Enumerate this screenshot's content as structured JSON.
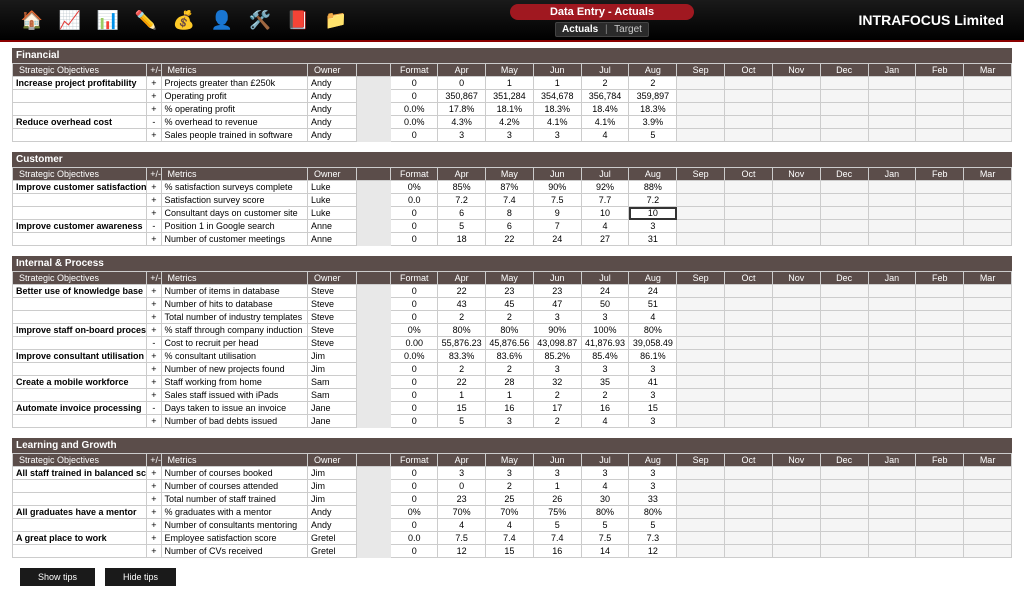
{
  "header": {
    "title": "Data Entry - Actuals",
    "tabs": {
      "actuals": "Actuals",
      "target": "Target"
    },
    "company": "INTRAFOCUS Limited",
    "icons": [
      "home-icon",
      "chart-icon",
      "bar-chart-icon",
      "pencil-icon",
      "coins-icon",
      "person-icon",
      "tools-icon",
      "book-icon",
      "folder-icon"
    ]
  },
  "months": [
    "Apr",
    "May",
    "Jun",
    "Jul",
    "Aug",
    "Sep",
    "Oct",
    "Nov",
    "Dec",
    "Jan",
    "Feb",
    "Mar"
  ],
  "column_headers": {
    "objectives": "Strategic Objectives",
    "pm": "+/-",
    "metrics": "Metrics",
    "owner": "Owner",
    "format": "Format"
  },
  "sections": [
    {
      "title": "Financial",
      "rows": [
        {
          "obj": "Increase project profitability",
          "pm": "+",
          "metric": "Projects greater than £250k",
          "owner": "Andy",
          "fmt": "0",
          "vals": [
            "0",
            "1",
            "1",
            "2",
            "2",
            "",
            "",
            "",
            "",
            "",
            "",
            ""
          ]
        },
        {
          "obj": "",
          "pm": "+",
          "metric": "Operating profit",
          "owner": "Andy",
          "fmt": "0",
          "vals": [
            "350,867",
            "351,284",
            "354,678",
            "356,784",
            "359,897",
            "",
            "",
            "",
            "",
            "",
            "",
            ""
          ]
        },
        {
          "obj": "",
          "pm": "+",
          "metric": "% operating profit",
          "owner": "Andy",
          "fmt": "0.0%",
          "vals": [
            "17.8%",
            "18.1%",
            "18.3%",
            "18.4%",
            "18.3%",
            "",
            "",
            "",
            "",
            "",
            "",
            ""
          ]
        },
        {
          "obj": "Reduce overhead cost",
          "pm": "-",
          "metric": "% overhead to revenue",
          "owner": "Andy",
          "fmt": "0.0%",
          "vals": [
            "4.3%",
            "4.2%",
            "4.1%",
            "4.1%",
            "3.9%",
            "",
            "",
            "",
            "",
            "",
            "",
            ""
          ]
        },
        {
          "obj": "",
          "pm": "+",
          "metric": "Sales people trained in software",
          "owner": "Andy",
          "fmt": "0",
          "vals": [
            "3",
            "3",
            "3",
            "4",
            "5",
            "",
            "",
            "",
            "",
            "",
            "",
            ""
          ]
        }
      ]
    },
    {
      "title": "Customer",
      "rows": [
        {
          "obj": "Improve customer satisfaction",
          "pm": "+",
          "metric": "% satisfaction surveys complete",
          "owner": "Luke",
          "fmt": "0%",
          "vals": [
            "85%",
            "87%",
            "90%",
            "92%",
            "88%",
            "",
            "",
            "",
            "",
            "",
            "",
            ""
          ]
        },
        {
          "obj": "",
          "pm": "+",
          "metric": "Satisfaction survey score",
          "owner": "Luke",
          "fmt": "0.0",
          "vals": [
            "7.2",
            "7.4",
            "7.5",
            "7.7",
            "7.2",
            "",
            "",
            "",
            "",
            "",
            "",
            ""
          ]
        },
        {
          "obj": "",
          "pm": "+",
          "metric": "Consultant days on customer site",
          "owner": "Luke",
          "fmt": "0",
          "vals": [
            "6",
            "8",
            "9",
            "10",
            "10",
            "",
            "",
            "",
            "",
            "",
            "",
            ""
          ],
          "selected": 4
        },
        {
          "obj": "Improve customer awareness",
          "pm": "-",
          "metric": "Position 1 in Google search",
          "owner": "Anne",
          "fmt": "0",
          "vals": [
            "5",
            "6",
            "7",
            "4",
            "3",
            "",
            "",
            "",
            "",
            "",
            "",
            ""
          ]
        },
        {
          "obj": "",
          "pm": "+",
          "metric": "Number of customer meetings",
          "owner": "Anne",
          "fmt": "0",
          "vals": [
            "18",
            "22",
            "24",
            "27",
            "31",
            "",
            "",
            "",
            "",
            "",
            "",
            ""
          ]
        }
      ]
    },
    {
      "title": "Internal & Process",
      "rows": [
        {
          "obj": "Better use of knowledge base",
          "pm": "+",
          "metric": "Number of items in database",
          "owner": "Steve",
          "fmt": "0",
          "vals": [
            "22",
            "23",
            "23",
            "24",
            "24",
            "",
            "",
            "",
            "",
            "",
            "",
            ""
          ]
        },
        {
          "obj": "",
          "pm": "+",
          "metric": "Number of hits to database",
          "owner": "Steve",
          "fmt": "0",
          "vals": [
            "43",
            "45",
            "47",
            "50",
            "51",
            "",
            "",
            "",
            "",
            "",
            "",
            ""
          ]
        },
        {
          "obj": "",
          "pm": "+",
          "metric": "Total number of industry templates",
          "owner": "Steve",
          "fmt": "0",
          "vals": [
            "2",
            "2",
            "3",
            "3",
            "4",
            "",
            "",
            "",
            "",
            "",
            "",
            ""
          ]
        },
        {
          "obj": "Improve staff on-board process",
          "pm": "+",
          "metric": "% staff through company induction",
          "owner": "Steve",
          "fmt": "0%",
          "vals": [
            "80%",
            "80%",
            "90%",
            "100%",
            "80%",
            "",
            "",
            "",
            "",
            "",
            "",
            ""
          ]
        },
        {
          "obj": "",
          "pm": "-",
          "metric": "Cost to recruit per head",
          "owner": "Steve",
          "fmt": "0.00",
          "vals": [
            "55,876.23",
            "45,876.56",
            "43,098.87",
            "41,876.93",
            "39,058.49",
            "",
            "",
            "",
            "",
            "",
            "",
            ""
          ]
        },
        {
          "obj": "Improve consultant utilisation",
          "pm": "+",
          "metric": "% consultant utilisation",
          "owner": "Jim",
          "fmt": "0.0%",
          "vals": [
            "83.3%",
            "83.6%",
            "85.2%",
            "85.4%",
            "86.1%",
            "",
            "",
            "",
            "",
            "",
            "",
            ""
          ]
        },
        {
          "obj": "",
          "pm": "+",
          "metric": "Number of new projects found",
          "owner": "Jim",
          "fmt": "0",
          "vals": [
            "2",
            "2",
            "3",
            "3",
            "3",
            "",
            "",
            "",
            "",
            "",
            "",
            ""
          ]
        },
        {
          "obj": "Create a mobile workforce",
          "pm": "+",
          "metric": "Staff working from home",
          "owner": "Sam",
          "fmt": "0",
          "vals": [
            "22",
            "28",
            "32",
            "35",
            "41",
            "",
            "",
            "",
            "",
            "",
            "",
            ""
          ]
        },
        {
          "obj": "",
          "pm": "+",
          "metric": "Sales staff issued with iPads",
          "owner": "Sam",
          "fmt": "0",
          "vals": [
            "1",
            "1",
            "2",
            "2",
            "3",
            "",
            "",
            "",
            "",
            "",
            "",
            ""
          ]
        },
        {
          "obj": "Automate invoice processing",
          "pm": "-",
          "metric": "Days taken to issue an invoice",
          "owner": "Jane",
          "fmt": "0",
          "vals": [
            "15",
            "16",
            "17",
            "16",
            "15",
            "",
            "",
            "",
            "",
            "",
            "",
            ""
          ]
        },
        {
          "obj": "",
          "pm": "+",
          "metric": "Number of bad debts issued",
          "owner": "Jane",
          "fmt": "0",
          "vals": [
            "5",
            "3",
            "2",
            "4",
            "3",
            "",
            "",
            "",
            "",
            "",
            "",
            ""
          ]
        }
      ]
    },
    {
      "title": "Learning and Growth",
      "rows": [
        {
          "obj": "All staff trained in balanced score",
          "pm": "+",
          "metric": "Number of courses booked",
          "owner": "Jim",
          "fmt": "0",
          "vals": [
            "3",
            "3",
            "3",
            "3",
            "3",
            "",
            "",
            "",
            "",
            "",
            "",
            ""
          ]
        },
        {
          "obj": "",
          "pm": "+",
          "metric": "Number of courses attended",
          "owner": "Jim",
          "fmt": "0",
          "vals": [
            "0",
            "2",
            "1",
            "4",
            "3",
            "",
            "",
            "",
            "",
            "",
            "",
            ""
          ]
        },
        {
          "obj": "",
          "pm": "+",
          "metric": "Total number of staff trained",
          "owner": "Jim",
          "fmt": "0",
          "vals": [
            "23",
            "25",
            "26",
            "30",
            "33",
            "",
            "",
            "",
            "",
            "",
            "",
            ""
          ]
        },
        {
          "obj": "All graduates have a mentor",
          "pm": "+",
          "metric": "% graduates with a mentor",
          "owner": "Andy",
          "fmt": "0%",
          "vals": [
            "70%",
            "70%",
            "75%",
            "80%",
            "80%",
            "",
            "",
            "",
            "",
            "",
            "",
            ""
          ]
        },
        {
          "obj": "",
          "pm": "+",
          "metric": "Number of consultants mentoring",
          "owner": "Andy",
          "fmt": "0",
          "vals": [
            "4",
            "4",
            "5",
            "5",
            "5",
            "",
            "",
            "",
            "",
            "",
            "",
            ""
          ]
        },
        {
          "obj": "A great place to work",
          "pm": "+",
          "metric": "Employee satisfaction score",
          "owner": "Gretel",
          "fmt": "0.0",
          "vals": [
            "7.5",
            "7.4",
            "7.4",
            "7.5",
            "7.3",
            "",
            "",
            "",
            "",
            "",
            "",
            ""
          ]
        },
        {
          "obj": "",
          "pm": "+",
          "metric": "Number of CVs received",
          "owner": "Gretel",
          "fmt": "0",
          "vals": [
            "12",
            "15",
            "16",
            "14",
            "12",
            "",
            "",
            "",
            "",
            "",
            "",
            ""
          ]
        }
      ]
    }
  ],
  "footer": {
    "show_tips": "Show tips",
    "hide_tips": "Hide tips"
  }
}
